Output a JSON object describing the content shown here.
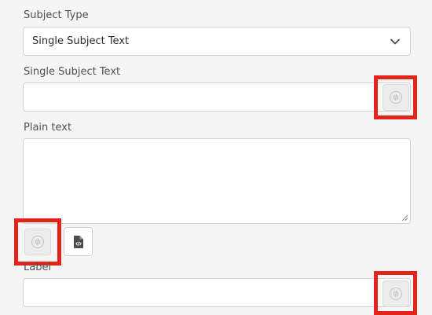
{
  "form": {
    "subject_type_label": "Subject Type",
    "subject_type_value": "Single Subject Text",
    "single_subject_label": "Single Subject Text",
    "single_subject_value": "",
    "plain_text_label": "Plain text",
    "plain_text_value": "",
    "label_label": "Label",
    "label_value": ""
  },
  "icons": {
    "dropdown": "chevron-down-icon",
    "link": "link-icon",
    "source": "file-code-icon",
    "resize": "resize-grip-icon"
  },
  "colors": {
    "background": "#f5f5f5",
    "highlight": "#e3241b",
    "field_border": "#d3d3d3",
    "label_text": "#505050"
  }
}
